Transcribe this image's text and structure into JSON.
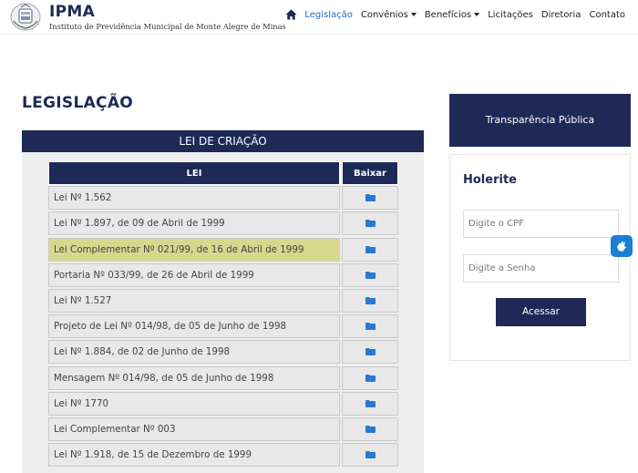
{
  "brand": {
    "title": "IPMA",
    "subtitle": "Instituto de Previdência Municipal de Monte Alegre de Minas"
  },
  "nav": {
    "items": [
      {
        "label": "Legislação",
        "dropdown": false
      },
      {
        "label": "Convênios",
        "dropdown": true
      },
      {
        "label": "Benefícios",
        "dropdown": true
      },
      {
        "label": "Licitações",
        "dropdown": false
      },
      {
        "label": "Diretoria",
        "dropdown": false
      },
      {
        "label": "Contato",
        "dropdown": false
      }
    ]
  },
  "page": {
    "title": "LEGISLAÇÃO"
  },
  "section": {
    "heading": "LEI DE CRIAÇÃO",
    "columns": {
      "lei": "LEI",
      "baixar": "Baixar"
    },
    "rows": [
      {
        "lei": "Lei Nº 1.562"
      },
      {
        "lei": "Lei Nº 1.897, de 09 de Abril de 1999"
      },
      {
        "lei": "Lei Complementar Nº 021/99, de 16 de Abril de 1999"
      },
      {
        "lei": "Portaria Nº 033/99, de 26 de Abril de 1999"
      },
      {
        "lei": "Lei Nº 1.527"
      },
      {
        "lei": "Projeto de Lei Nº 014/98, de 05 de Junho de 1998"
      },
      {
        "lei": "Lei Nº 1.884, de 02 de Junho de 1998"
      },
      {
        "lei": "Mensagem Nº 014/98, de 05 de Junho de 1998"
      },
      {
        "lei": "Lei Nº 1770"
      },
      {
        "lei": "Lei Complementar Nº 003"
      },
      {
        "lei": "Lei Nº 1.918, de 15 de Dezembro de 1999"
      }
    ],
    "highlighted_row": 2
  },
  "sidebar": {
    "transparencia": "Transparência Pública",
    "holerite": {
      "title": "Holerite",
      "cpf_placeholder": "Digite o CPF",
      "senha_placeholder": "Digite a Senha",
      "submit": "Acessar"
    }
  },
  "colors": {
    "navy": "#1d2a56",
    "link": "#1a6fc9",
    "highlight": "#d7d88e",
    "folder": "#2a78d0"
  },
  "icons": {
    "home": "home-icon",
    "download": "folder-icon",
    "accessibility": "sign-language-icon"
  }
}
